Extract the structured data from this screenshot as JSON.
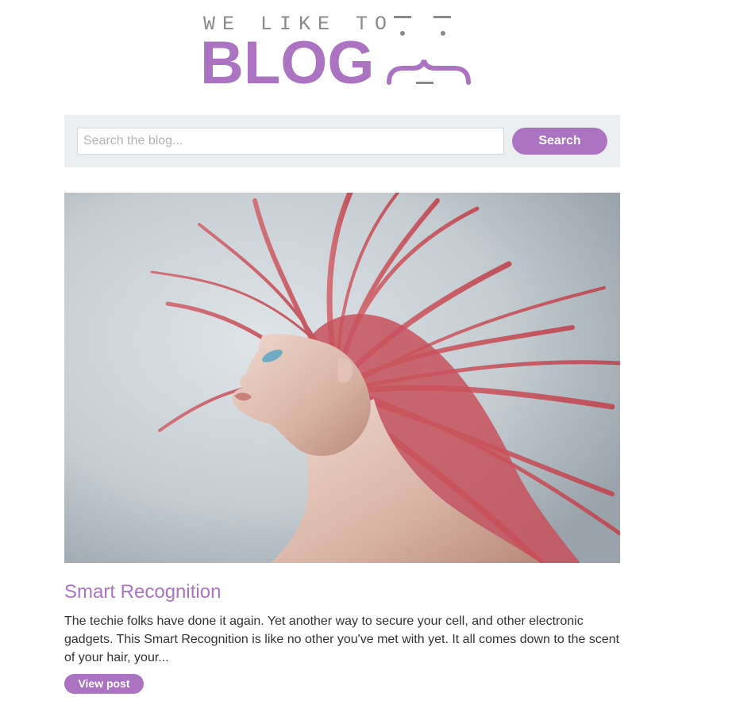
{
  "header": {
    "logo_tagline": "WE LIKE TO",
    "logo_word": "BLOG"
  },
  "search": {
    "placeholder": "Search the blog...",
    "value": "",
    "button_label": "Search"
  },
  "post": {
    "image_alt": "Woman with flowing pink hair",
    "title": "Smart Recognition",
    "excerpt": "The techie folks have done it again. Yet another way to secure your cell, and other electronic gadgets. This Smart Recognition is like no other you've met with yet. It all comes down to the scent of your hair, your...",
    "view_label": "View post"
  },
  "colors": {
    "accent": "#ab73c2",
    "search_bar_bg": "#ebeff2",
    "body_text": "#333333"
  }
}
